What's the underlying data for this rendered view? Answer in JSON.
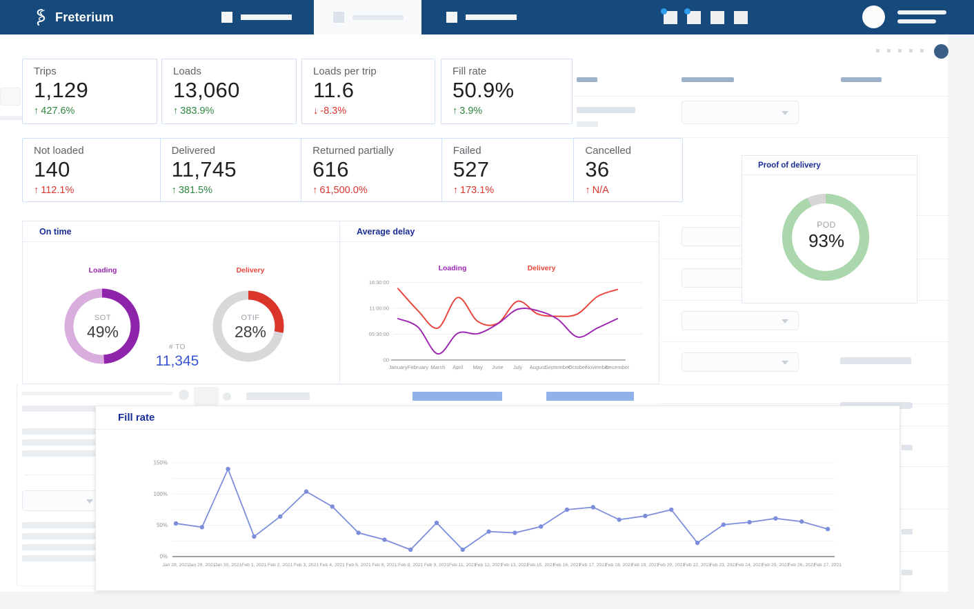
{
  "navbar": {
    "brand": "Freterium"
  },
  "kpi_row1": [
    {
      "label": "Trips",
      "value": "1,129",
      "arrow": "↑",
      "delta": "427.6%",
      "tone": "positive"
    },
    {
      "label": "Loads",
      "value": "13,060",
      "arrow": "↑",
      "delta": "383.9%",
      "tone": "positive"
    },
    {
      "label": "Loads per trip",
      "value": "11.6",
      "arrow": "↓",
      "delta": "-8.3%",
      "tone": "negative"
    },
    {
      "label": "Fill rate",
      "value": "50.9%",
      "arrow": "↑",
      "delta": "3.9%",
      "tone": "positive"
    }
  ],
  "kpi_row2": [
    {
      "label": "Not loaded",
      "value": "140",
      "arrow": "↑",
      "delta": "112.1%",
      "tone": "negative"
    },
    {
      "label": "Delivered",
      "value": "11,745",
      "arrow": "↑",
      "delta": "381.5%",
      "tone": "positive"
    },
    {
      "label": "Returned partially",
      "value": "616",
      "arrow": "↑",
      "delta": "61,500.0%",
      "tone": "negative"
    },
    {
      "label": "Failed",
      "value": "527",
      "arrow": "↑",
      "delta": "173.1%",
      "tone": "negative"
    },
    {
      "label": "Cancelled",
      "value": "36",
      "arrow": "↑",
      "delta": "N/A",
      "tone": "negative"
    }
  ],
  "on_time": {
    "title": "On time",
    "loading_legend": "Loading",
    "delivery_legend": "Delivery",
    "sot_label": "SOT",
    "sot_value": "49%",
    "otif_label": "OTIF",
    "otif_value": "28%",
    "to_label": "# TO",
    "to_value": "11,345"
  },
  "average_delay": {
    "title": "Average delay",
    "loading_legend": "Loading",
    "delivery_legend": "Delivery"
  },
  "proof_of_delivery": {
    "title": "Proof of delivery",
    "center_label": "POD",
    "center_value": "93%"
  },
  "fill_rate_panel": {
    "title": "Fill rate"
  },
  "colors": {
    "navbar": "#174a7c",
    "accent_title": "#1a2d96",
    "positive": "#2e8540",
    "negative": "#d6372e",
    "loading_purple": "#8e24aa",
    "loading_purple_light": "#d9aede",
    "delivery_red": "#da352b",
    "neutral_gray": "#d8d8d8",
    "pod_green": "#abd7ac",
    "fill_rate_line": "#7c8edb",
    "card_border": "#cfe0f5"
  },
  "chart_data": [
    {
      "id": "sot_donut",
      "type": "pie",
      "title": "Loading",
      "center_label": "SOT",
      "center_value": "49%",
      "values": [
        49,
        51
      ],
      "colors": [
        "#8e24aa",
        "#d9aede"
      ]
    },
    {
      "id": "otif_donut",
      "type": "pie",
      "title": "Delivery",
      "center_label": "OTIF",
      "center_value": "28%",
      "values": [
        28,
        72
      ],
      "colors": [
        "#da352b",
        "#d8d8d8"
      ]
    },
    {
      "id": "pod_donut",
      "type": "pie",
      "title": "Proof of delivery",
      "center_label": "POD",
      "center_value": "93%",
      "values": [
        93,
        7
      ],
      "colors": [
        "#abd7ac",
        "#d6d6d6"
      ]
    },
    {
      "id": "average_delay",
      "type": "line",
      "title": "Average delay",
      "x": [
        "January",
        "February",
        "March",
        "April",
        "May",
        "June",
        "July",
        "August",
        "September",
        "October",
        "November",
        "December"
      ],
      "series": [
        {
          "name": "Loading",
          "color": "#9c27b0",
          "values": [
            8.8,
            7.0,
            1.3,
            5.7,
            5.6,
            7.7,
            10.8,
            10.5,
            8.7,
            4.9,
            6.8,
            8.8
          ]
        },
        {
          "name": "Delivery",
          "color": "#e8453c",
          "values": [
            15.2,
            10.5,
            6.8,
            13.3,
            8.2,
            7.8,
            12.5,
            9.8,
            9.3,
            9.8,
            13.5,
            15.0
          ]
        }
      ],
      "ylim": [
        0,
        18
      ],
      "yticks": [
        {
          "value": 0,
          "label": "00"
        },
        {
          "value": 5.5,
          "label": "05:30:00"
        },
        {
          "value": 11,
          "label": "11:00:00"
        },
        {
          "value": 16.5,
          "label": "16:30:00"
        }
      ],
      "smooth": true,
      "legend_position": "top",
      "grid": true
    },
    {
      "id": "fill_rate",
      "type": "line",
      "title": "Fill rate",
      "x": [
        "Jan 28, 2021",
        "Jan 29, 2021",
        "Jan 30, 2021",
        "Feb 1, 2021",
        "Feb 2, 2021",
        "Feb 3, 2021",
        "Feb 4, 2021",
        "Feb 5, 2021",
        "Feb 6, 2021",
        "Feb 8, 2021",
        "Feb 9, 2021",
        "Feb 11, 2021",
        "Feb 12, 2021",
        "Feb 13, 2021",
        "Feb 15, 2021",
        "Feb 16, 2021",
        "Feb 17, 2021",
        "Feb 18, 2021",
        "Feb 19, 2021",
        "Feb 20, 2021",
        "Feb 22, 2021",
        "Feb 23, 2021",
        "Feb 24, 2021",
        "Feb 25, 2021",
        "Feb 26, 2021",
        "Feb 27, 2021"
      ],
      "series": [
        {
          "name": "Fill rate",
          "color": "#7c8edb",
          "values": [
            53,
            47,
            140,
            32,
            64,
            104,
            80,
            38,
            27,
            11,
            54,
            11,
            40,
            38,
            48,
            75,
            79,
            59,
            65,
            75,
            22,
            51,
            55,
            61,
            56,
            44
          ]
        }
      ],
      "ylim": [
        0,
        160
      ],
      "yticks": [
        {
          "value": 0,
          "label": "0%"
        },
        {
          "value": 50,
          "label": "50%"
        },
        {
          "value": 100,
          "label": "100%"
        },
        {
          "value": 150,
          "label": "150%"
        }
      ],
      "grid_step": 25,
      "markers": true,
      "grid": true
    }
  ]
}
